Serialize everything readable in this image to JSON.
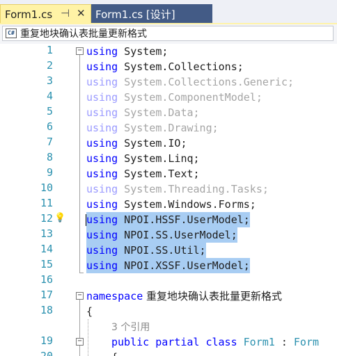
{
  "tabs": {
    "active_label": "Form1.cs",
    "pin_glyph": "⊣",
    "close_glyph": "✕",
    "inactive_label": "Form1.cs [设计]"
  },
  "navbar": {
    "icon_text": "C#",
    "namespace": "重复地块确认表批量更新格式"
  },
  "line_numbers": [
    "1",
    "2",
    "3",
    "4",
    "5",
    "6",
    "7",
    "8",
    "9",
    "10",
    "11",
    "12",
    "13",
    "14",
    "15",
    "16",
    "17",
    "18",
    "19",
    "20"
  ],
  "code": {
    "l1": {
      "kw": "using",
      "name": " System;"
    },
    "l2": {
      "kw": "using",
      "name": " System.Collections;"
    },
    "l3": {
      "kw": "using",
      "name": " System.Collections.Generic;"
    },
    "l4": {
      "kw": "using",
      "name": " System.ComponentModel;"
    },
    "l5": {
      "kw": "using",
      "name": " System.Data;"
    },
    "l6": {
      "kw": "using",
      "name": " System.Drawing;"
    },
    "l7": {
      "kw": "using",
      "name": " System.IO;"
    },
    "l8": {
      "kw": "using",
      "name": " System.Linq;"
    },
    "l9": {
      "kw": "using",
      "name": " System.Text;"
    },
    "l10": {
      "kw": "using",
      "name": " System.Threading.Tasks;"
    },
    "l11": {
      "kw": "using",
      "name": " System.Windows.Forms;"
    },
    "l12": {
      "kw": "using",
      "name": " NPOI.HSSF.UserModel;"
    },
    "l13": {
      "kw": "using",
      "name": " NPOI.SS.UserModel;"
    },
    "l14": {
      "kw": "using",
      "name": " NPOI.SS.Util;"
    },
    "l15": {
      "kw": "using",
      "name": " NPOI.XSSF.UserModel;"
    },
    "l17": {
      "kw": "namespace",
      "name": " 重复地块确认表批量更新格式"
    },
    "l18": {
      "text": "{"
    },
    "refs": "3 个引用",
    "l19": {
      "kw1": "public",
      "kw2": " partial",
      "kw3": " class",
      "type1": " Form1",
      "colon": " :",
      "type2": " Form"
    },
    "l20": {
      "text": "{"
    }
  },
  "colors": {
    "keyword": "#0000ff",
    "type": "#2b91af",
    "selection": "#a8cdf3",
    "active_tab": "#fff3a6",
    "inactive_tab": "#435b86"
  }
}
